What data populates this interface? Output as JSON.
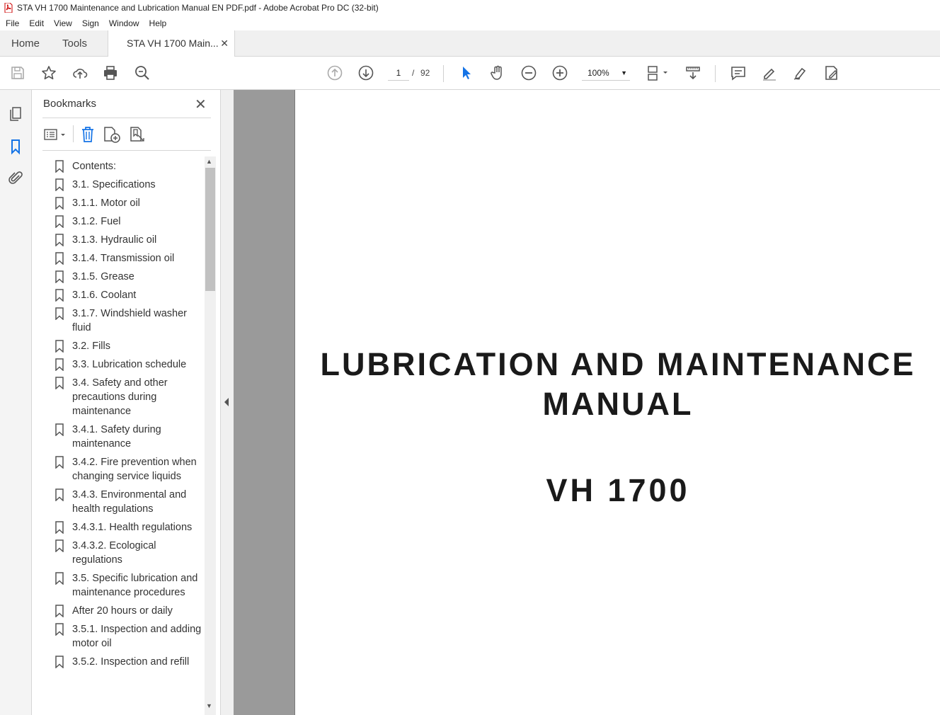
{
  "window": {
    "title": "STA VH 1700 Maintenance and Lubrication Manual EN PDF.pdf - Adobe Acrobat Pro DC (32-bit)"
  },
  "menu": [
    "File",
    "Edit",
    "View",
    "Sign",
    "Window",
    "Help"
  ],
  "tabs": {
    "home": "Home",
    "tools": "Tools",
    "document": "STA VH 1700 Main..."
  },
  "toolbar": {
    "page_current": "1",
    "page_sep": "/",
    "page_total": "92",
    "zoom": "100%"
  },
  "bookmarks_panel": {
    "title": "Bookmarks",
    "items": [
      "Contents:",
      "3.1. Specifications",
      "3.1.1. Motor oil",
      "3.1.2. Fuel",
      "3.1.3. Hydraulic oil",
      "3.1.4. Transmission oil",
      "3.1.5. Grease",
      "3.1.6. Coolant",
      "3.1.7. Windshield washer fluid",
      "3.2. Fills",
      "3.3. Lubrication schedule",
      "3.4. Safety and other precautions during maintenance",
      "3.4.1. Safety during maintenance",
      "3.4.2. Fire prevention when changing service liquids",
      "3.4.3. Environmental and health regulations",
      "3.4.3.1. Health regulations",
      "3.4.3.2. Ecological regulations",
      "3.5. Specific lubrication and maintenance procedures",
      "After 20 hours or daily",
      "3.5.1.   Inspection and adding motor oil",
      "3.5.2.   Inspection and refill"
    ]
  },
  "document": {
    "title_line1": "LUBRICATION AND MAINTENANCE",
    "title_line2": "MANUAL",
    "model": "VH 1700"
  },
  "colors": {
    "accent_blue": "#1473e6",
    "panel_bg": "#f4f4f4",
    "doc_bg": "#9a9a9a"
  }
}
